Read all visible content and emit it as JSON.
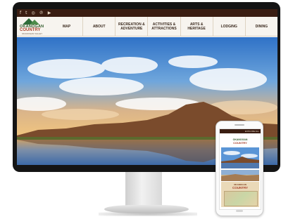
{
  "site": {
    "logo_line1": "OKANOGAN",
    "logo_line2": "COUNTRY",
    "logo_tagline": "OKANOGAN VALLEY"
  },
  "social_icons": [
    {
      "name": "facebook-icon",
      "glyph": "f"
    },
    {
      "name": "twitter-icon",
      "glyph": "t"
    },
    {
      "name": "instagram-icon",
      "glyph": "◎"
    },
    {
      "name": "pinterest-icon",
      "glyph": "℗"
    },
    {
      "name": "youtube-icon",
      "glyph": "▶"
    }
  ],
  "nav": {
    "items": [
      {
        "label": "MAP"
      },
      {
        "label": "ABOUT"
      },
      {
        "label": "RECREATION & ADVENTURE"
      },
      {
        "label": "ACTIVITIES & ATTRACTIONS"
      },
      {
        "label": "ARTS & HERITAGE"
      },
      {
        "label": "LODGING"
      },
      {
        "label": "DINING"
      }
    ]
  },
  "phone": {
    "top_bar_text": "EXPLORE ALL",
    "logo_line1": "OKANOGAN",
    "logo_line2": "COUNTRY",
    "promo_small": "OKANOGAN",
    "promo_title": "COUNTRY"
  },
  "colors": {
    "top_bar": "#3a1d12",
    "nav_bg": "#f7f4ef",
    "logo_green": "#2e5a2a",
    "logo_red": "#a8402a"
  }
}
